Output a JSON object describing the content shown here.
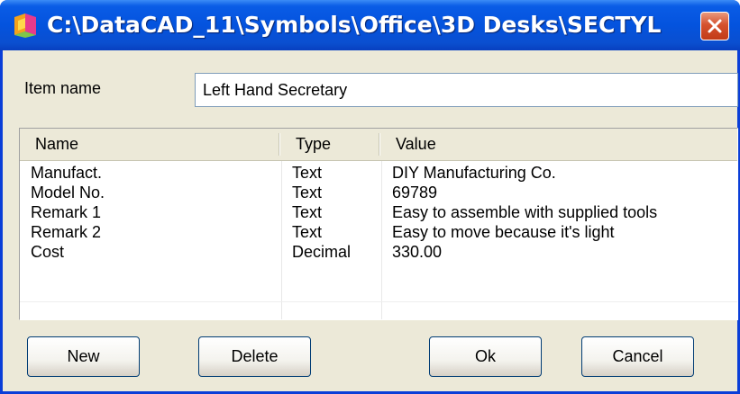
{
  "window": {
    "title": "C:\\DataCAD_11\\Symbols\\Office\\3D Desks\\SECTYL"
  },
  "item": {
    "label": "Item name",
    "value": "Left Hand Secretary"
  },
  "grid": {
    "columns": [
      "Name",
      "Type",
      "Value"
    ],
    "rows": [
      [
        "Manufact.",
        "Text",
        "DIY Manufacturing Co."
      ],
      [
        "Model No.",
        "Text",
        "69789"
      ],
      [
        "Remark 1",
        "Text",
        "Easy to assemble with supplied tools"
      ],
      [
        "Remark 2",
        "Text",
        "Easy to move because it's light"
      ],
      [
        "Cost",
        "Decimal",
        "330.00"
      ]
    ]
  },
  "buttons": {
    "new": "New",
    "delete": "Delete",
    "ok": "Ok",
    "cancel": "Cancel"
  },
  "colors": {
    "titlebar": "#0453de",
    "face": "#ece9d8",
    "close": "#d5512e"
  },
  "icons": {
    "app": "datacad-app-icon",
    "close": "close-icon"
  }
}
